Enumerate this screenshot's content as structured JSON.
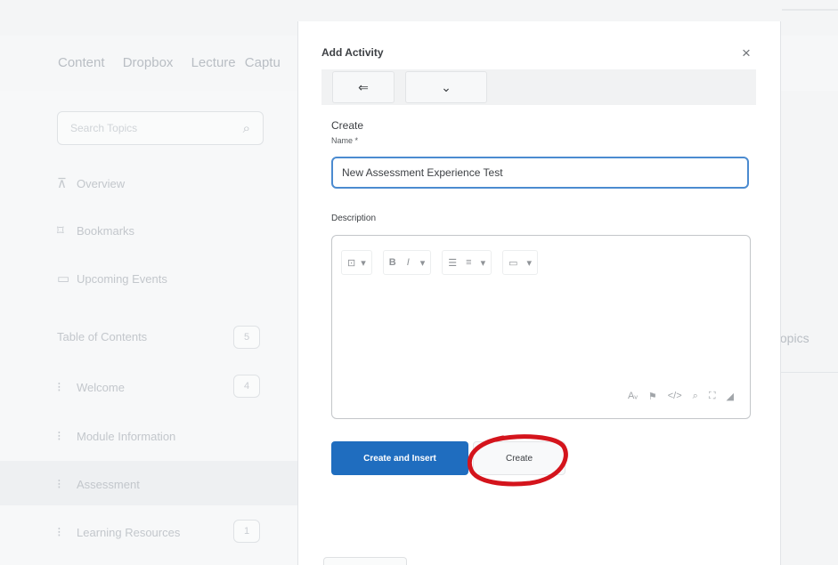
{
  "background": {
    "nav_tabs": [
      "Content",
      "Dropbox",
      "Lecture Captu"
    ],
    "search_placeholder": "Search Topics",
    "sidebar": {
      "overview": "Overview",
      "bookmarks": "Bookmarks",
      "upcoming": "Upcoming Events",
      "toc": "Table of Contents",
      "toc_count": "5",
      "modules": [
        {
          "label": "Welcome",
          "count": "4"
        },
        {
          "label": "Module Information",
          "count": ""
        },
        {
          "label": "Assessment",
          "count": ""
        },
        {
          "label": "Learning Resources",
          "count": "1"
        }
      ]
    },
    "right_text": "topics"
  },
  "dialog": {
    "title": "Add Activity",
    "close_icon": "×",
    "toolbar": {
      "back_icon": "⇐",
      "dropdown_icon": "⌄"
    },
    "section_title": "Create",
    "name_label": "Name *",
    "name_value": "New Assessment Experience Test",
    "description_label": "Description",
    "editor_toolbar": {
      "insert_icon": "⊡",
      "bold": "B",
      "italic": "I",
      "align_icon": "☰",
      "list_icon": "≡",
      "media_icon": "▭",
      "caret": "▾"
    },
    "editor_footer": [
      "Aᵥ",
      "⚑",
      "</>",
      "⌕",
      "⛶",
      "◢"
    ],
    "buttons": {
      "create_and_insert": "Create and Insert",
      "create": "Create"
    },
    "annotation_color": "#d4141c",
    "accent_color": "#1f6dbf"
  }
}
